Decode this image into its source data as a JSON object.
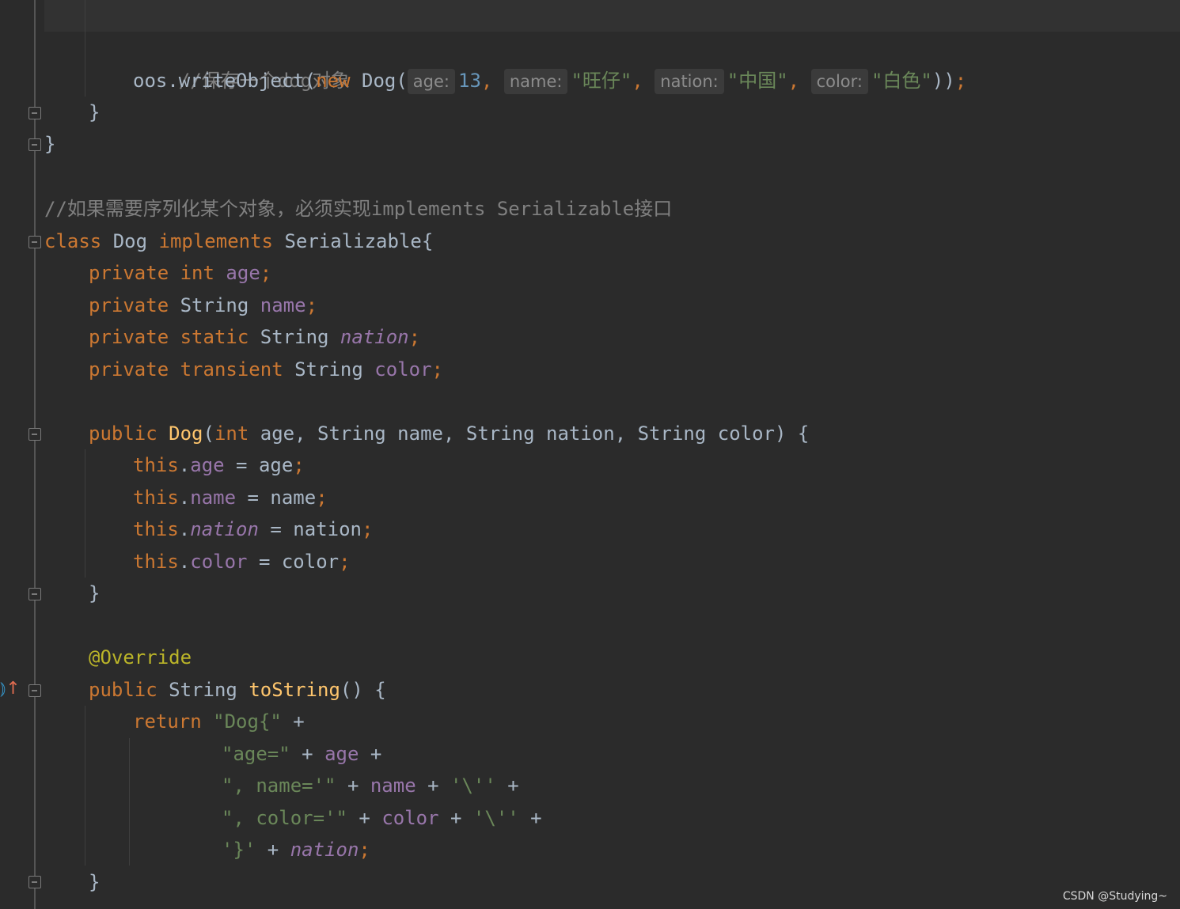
{
  "code": {
    "comment_save": "//保存一个dog对象",
    "write_call": {
      "receiver": "oos.writeObject(",
      "new_kw": "new",
      "ctor": " Dog(",
      "hint_age": "age:",
      "age_value": "13",
      "hint_name": "name:",
      "name_value": "\"旺仔\"",
      "hint_nation": "nation:",
      "nation_value": "\"中国\"",
      "hint_color": "color:",
      "color_value": "\"白色\"",
      "close": "))",
      "semi": ";"
    },
    "comment_serializable": "//如果需要序列化某个对象，必须实现implements Serializable接口",
    "class_kw": "class",
    "class_name": " Dog ",
    "implements_kw": "implements",
    "interface_name": " Serializable{",
    "private_kw": "private",
    "static_kw": "static",
    "transient_kw": "transient",
    "int_kw": "int",
    "string_type": "String",
    "field_age": "age",
    "field_name": "name",
    "field_nation": "nation",
    "field_color": "color",
    "public_kw": "public",
    "ctor_name": "Dog",
    "ctor_params_rest": " age, String name, String nation, String color) {",
    "this_kw": "this",
    "assign_age": " = age",
    "assign_name": " = name",
    "assign_nation": " = nation",
    "assign_color": " = color",
    "close_brace": "}",
    "annotation": "@Override",
    "method_name": "toString",
    "method_rest": "() {",
    "return_kw": "return",
    "str_dog": "\"Dog{\"",
    "str_age": "\"age=\"",
    "str_name": "\", name='\"",
    "str_color": "\", color='\"",
    "str_quote": "'\\''",
    "str_end": "'}'",
    "plus": " +",
    "plus_mid": " + "
  },
  "watermark": "CSDN @Studying~",
  "colors": {
    "background": "#2b2b2b",
    "keyword": "#cc7832",
    "field": "#9876aa",
    "string": "#6a8759",
    "number": "#6897bb",
    "comment": "#808080",
    "annotation": "#bbb529",
    "method": "#ffc66d",
    "text": "#a9b7c6"
  }
}
